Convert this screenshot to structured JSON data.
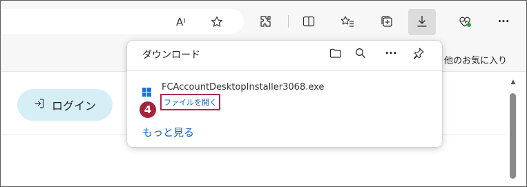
{
  "toolbar": {
    "icons": [
      "read-aloud-icon",
      "favorite-star-icon",
      "extensions-icon",
      "split-screen-icon",
      "favorites-icon",
      "collections-icon",
      "downloads-icon",
      "browser-essentials-icon",
      "more-icon"
    ],
    "read_aloud_glyph": "A⁾",
    "more_glyph": "···"
  },
  "favorites_bar": {
    "other_favorites": "他のお気に入り"
  },
  "page": {
    "login_label": "ログイン"
  },
  "downloads": {
    "title": "ダウンロード",
    "more_glyph": "···",
    "item": {
      "file_name": "FCAccountDesktopInstaller3068.exe",
      "open_file": "ファイルを開く"
    },
    "see_more": "もっと見る"
  },
  "annotation": {
    "step": "4",
    "color": "#a4243b"
  },
  "colors": {
    "link": "#0b62c4",
    "login_bg": "#d6eff6",
    "highlight_border": "#b0284f"
  }
}
